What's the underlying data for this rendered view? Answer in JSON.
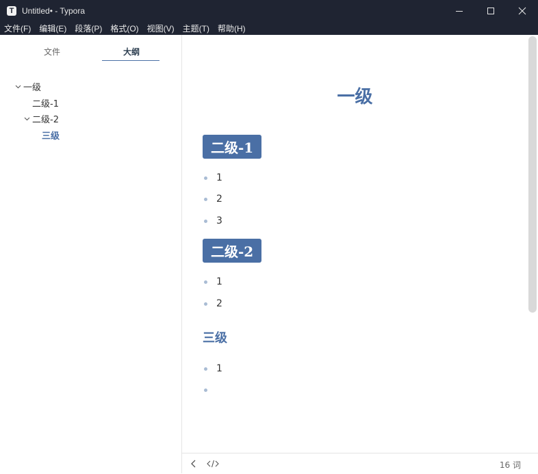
{
  "window": {
    "app_icon_letter": "T",
    "title": "Untitled• - Typora"
  },
  "menu": [
    "文件(F)",
    "编辑(E)",
    "段落(P)",
    "格式(O)",
    "视图(V)",
    "主题(T)",
    "帮助(H)"
  ],
  "sidebar": {
    "tabs": {
      "files": "文件",
      "outline": "大纲",
      "active": "outline"
    },
    "outline": [
      {
        "label": "一级",
        "level": 1,
        "expanded": true
      },
      {
        "label": "二级-1",
        "level": 2,
        "expanded": null
      },
      {
        "label": "二级-2",
        "level": 2,
        "expanded": true
      },
      {
        "label": "三级",
        "level": 3,
        "active": true
      }
    ]
  },
  "document": {
    "h1": "一级",
    "h2_a": "二级-1",
    "list_a": [
      "1",
      "2",
      "3"
    ],
    "h2_b": "二级-2",
    "list_b": [
      "1",
      "2"
    ],
    "h3": "三级",
    "list_c": [
      "1",
      ""
    ]
  },
  "status": {
    "word_count": "16 词"
  },
  "colors": {
    "accent": "#4a6fa5",
    "titlebar": "#1f2432",
    "bullet": "#a9bcd4"
  }
}
